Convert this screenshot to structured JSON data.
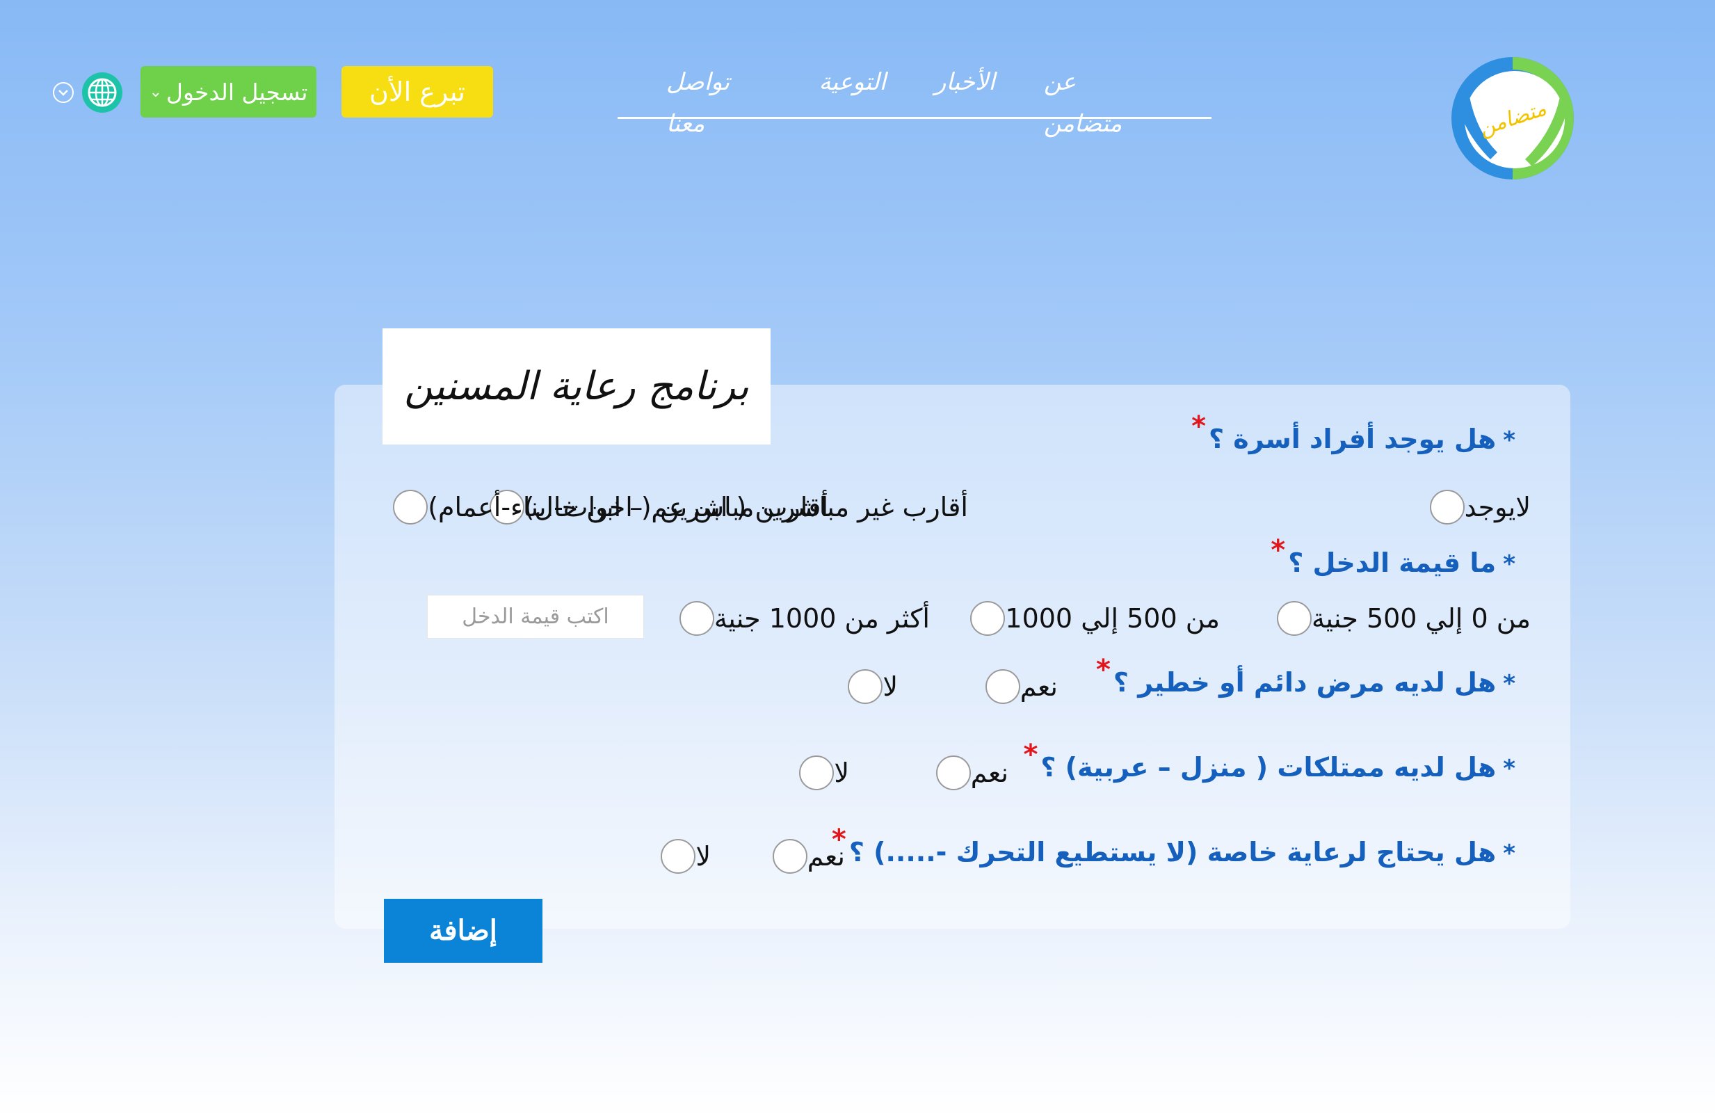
{
  "header": {
    "logo_text": "متضامن",
    "nav": [
      {
        "label": "عن متضامن"
      },
      {
        "label": "الأخبار"
      },
      {
        "label": "التوعية"
      },
      {
        "label": "تواصل معنا"
      }
    ],
    "donate_label": "تبرع الأن",
    "login_label": "تسجيل الدخول"
  },
  "form": {
    "title": "برنامج رعاية المسنين",
    "questions": [
      {
        "label": "هل يوجد أفراد أسرة ؟",
        "options": [
          "لايوجد",
          "أقارب غير مباشرين ( ابن عم – ابن خال)",
          "أقارب مباشرين ( اخوات-ابناء-أعمام)"
        ]
      },
      {
        "label": "ما قيمة الدخل ؟",
        "options": [
          "من 0 إلي 500 جنية",
          "من 500 إلي 1000",
          "أكثر من 1000 جنية"
        ],
        "input_placeholder": "اكتب قيمة الدخل"
      },
      {
        "label": "هل لديه مرض دائم أو خطير ؟",
        "options": [
          "نعم",
          "لا"
        ]
      },
      {
        "label": "هل لديه ممتلكات ( منزل – عربية) ؟",
        "options": [
          "نعم",
          "لا"
        ]
      },
      {
        "label": "هل يحتاج لرعاية خاصة (لا يستطيع التحرك -.....) ؟",
        "options": [
          "نعم",
          "لا"
        ]
      }
    ],
    "bullet": "*",
    "required_mark": "*",
    "submit_label": "إضافة"
  },
  "colors": {
    "accent_blue": "#1560bd",
    "donate_yellow": "#f6de12",
    "login_green": "#6fd04a",
    "submit_blue": "#0b84d8",
    "required_red": "#e3161b"
  },
  "icons": [
    "logo-icon",
    "globe-icon",
    "chevron-down-icon"
  ]
}
